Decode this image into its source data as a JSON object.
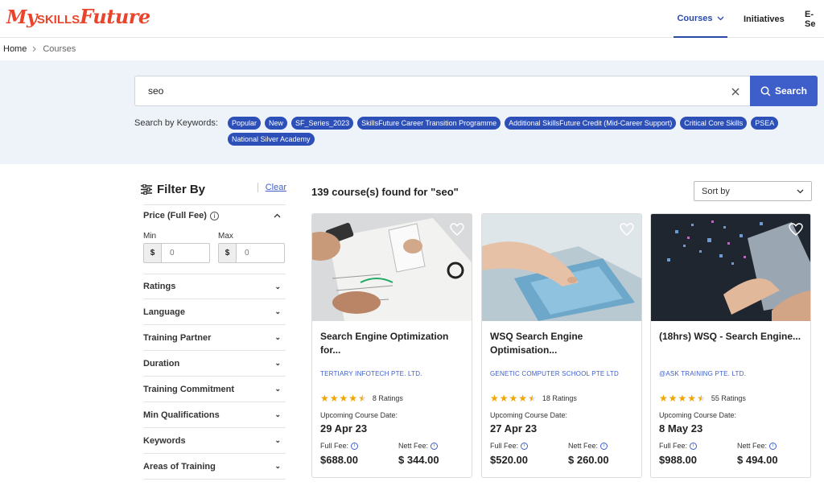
{
  "header": {
    "logo": {
      "my": "My",
      "skills": "SKILLS",
      "future": "Future"
    },
    "nav": {
      "courses": "Courses",
      "initiatives": "Initiatives",
      "ese": "E-Se"
    }
  },
  "breadcrumb": {
    "home": "Home",
    "current": "Courses"
  },
  "search": {
    "value": "seo",
    "button_label": "Search",
    "keywords_label": "Search by Keywords:",
    "keywords": [
      "Popular",
      "New",
      "SF_Series_2023",
      "SkillsFuture Career Transition Programme",
      "Additional SkillsFuture Credit (Mid-Career Support)",
      "Critical Core Skills",
      "PSEA",
      "National Silver Academy"
    ]
  },
  "filter": {
    "title": "Filter By",
    "clear": "Clear",
    "price": {
      "label": "Price (Full Fee)",
      "min_label": "Min",
      "max_label": "Max",
      "currency": "$",
      "min_value": "0",
      "max_value": "0"
    },
    "sections": [
      "Ratings",
      "Language",
      "Training Partner",
      "Duration",
      "Training Commitment",
      "Min Qualifications",
      "Keywords",
      "Areas of Training"
    ]
  },
  "results": {
    "count_text": "139 course(s) found for \"seo\"",
    "sort_label": "Sort by"
  },
  "cards": [
    {
      "title": "Search Engine Optimization for...",
      "provider": "TERTIARY INFOTECH PTE. LTD.",
      "rating": 4.5,
      "ratings_text": "8 Ratings",
      "upcoming_label": "Upcoming Course Date:",
      "date": "29 Apr 23",
      "full_fee_label": "Full Fee:",
      "full_fee": "$688.00",
      "nett_fee_label": "Nett Fee:",
      "nett_fee": "$ 344.00"
    },
    {
      "title": "WSQ Search Engine Optimisation...",
      "provider": "GENETIC COMPUTER SCHOOL PTE LTD",
      "rating": 4.5,
      "ratings_text": "18 Ratings",
      "upcoming_label": "Upcoming Course Date:",
      "date": "27 Apr 23",
      "full_fee_label": "Full Fee:",
      "full_fee": "$520.00",
      "nett_fee_label": "Nett Fee:",
      "nett_fee": "$ 260.00"
    },
    {
      "title": "(18hrs) WSQ - Search Engine...",
      "provider": "@ASK TRAINING PTE. LTD.",
      "rating": 4.5,
      "ratings_text": "55 Ratings",
      "upcoming_label": "Upcoming Course Date:",
      "date": "8 May 23",
      "full_fee_label": "Full Fee:",
      "full_fee": "$988.00",
      "nett_fee_label": "Nett Fee:",
      "nett_fee": "$ 494.00"
    }
  ],
  "colors": {
    "accent": "#3e5fc9",
    "tag": "#2c4fb8",
    "logo": "#e8452c",
    "star": "#f0a500",
    "band": "#eef2f9"
  }
}
